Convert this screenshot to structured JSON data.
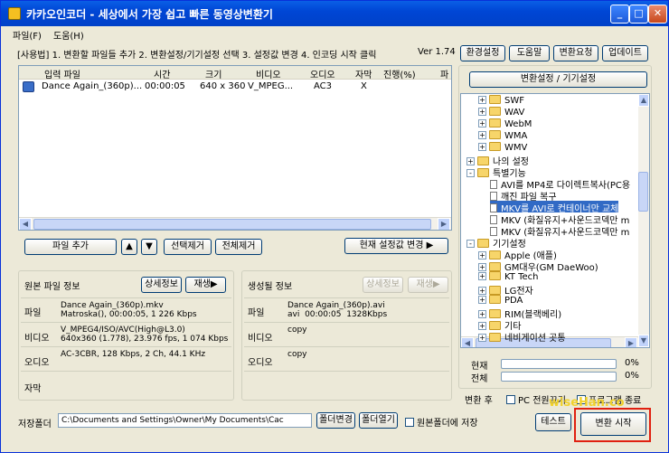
{
  "window": {
    "title": "카카오인코더 - 세상에서 가장 쉽고 빠른 동영상변환기"
  },
  "titlebar_buttons": {
    "minimize": "_",
    "maximize": "□",
    "close": "✕"
  },
  "menu": [
    "파일(F)",
    "도움(H)"
  ],
  "usage": "[사용법] 1. 변환할 파일들 추가  2. 변환설정/기기설정 선택  3. 설정값 변경  4. 인코딩 시작 클릭",
  "version": "Ver 1.74",
  "top_buttons": {
    "settings": "환경설정",
    "help": "도움말",
    "request": "변환요청",
    "update": "업데이트"
  },
  "grid": {
    "headers": [
      "입력 파일",
      "시간",
      "크기",
      "비디오",
      "오디오",
      "자막",
      "진행(%)",
      "파"
    ],
    "rows": [
      {
        "file": "Dance Again_(360p)...",
        "time": "00:00:05",
        "size": "640 x 360",
        "video": "V_MPEG...",
        "audio": "AC3",
        "sub": "X",
        "progress": ""
      }
    ]
  },
  "list_buttons": {
    "add": "파일 추가",
    "up": "▲",
    "down": "▼",
    "remove_sel": "선택제거",
    "remove_all": "전체제거",
    "apply": "현재 설정값 변경 ▶"
  },
  "source_info": {
    "title": "원본 파일 정보",
    "detail_btn": "상세정보",
    "play_btn": "재생▶",
    "labels": [
      "파일",
      "비디오",
      "오디오",
      "자막"
    ],
    "file": "Dance Again_(360p).mkv\nMatroska(), 00:00:05, 1 226 Kbps",
    "video": "V_MPEG4/ISO/AVC(High@L3.0)\n640x360 (1.778), 23.976 fps, 1 074 Kbps",
    "audio": "AC-3CBR, 128 Kbps, 2 Ch, 44.1 KHz",
    "sub": ""
  },
  "output_info": {
    "title": "생성될 정보",
    "detail_btn": "상세정보",
    "play_btn": "재생▶",
    "labels": [
      "파일",
      "비디오",
      "오디오"
    ],
    "file": "Dance Again_(360p).avi\navi  00:00:05  1328Kbps",
    "video": "copy",
    "audio": "copy"
  },
  "device_panel": {
    "title": "변환설정 / 기기설정"
  },
  "tree": [
    {
      "kind": "folder",
      "plus": "+",
      "label": "SWF",
      "indent": 1
    },
    {
      "kind": "folder",
      "plus": "+",
      "label": "WAV",
      "indent": 1
    },
    {
      "kind": "folder",
      "plus": "+",
      "label": "WebM",
      "indent": 1
    },
    {
      "kind": "folder",
      "plus": "+",
      "label": "WMA",
      "indent": 1
    },
    {
      "kind": "folder",
      "plus": "+",
      "label": "WMV",
      "indent": 1
    },
    {
      "kind": "folder",
      "plus": "+",
      "label": "나의 설정",
      "indent": 0
    },
    {
      "kind": "folder",
      "plus": "-",
      "label": "특별기능",
      "indent": 0
    },
    {
      "kind": "doc",
      "plus": "",
      "label": "AVI를 MP4로 다이렉트복사(PC용",
      "indent": 2
    },
    {
      "kind": "doc",
      "plus": "",
      "label": "깨진 파일 복구",
      "indent": 2
    },
    {
      "kind": "doc",
      "plus": "",
      "label": "MKV를 AVI로 컨테이너만 교체",
      "indent": 2,
      "selected": true
    },
    {
      "kind": "doc",
      "plus": "",
      "label": "MKV (화질유지+사운드코덱만 m",
      "indent": 2
    },
    {
      "kind": "doc",
      "plus": "",
      "label": "MKV (화질유지+사운드코덱만 m",
      "indent": 2
    },
    {
      "kind": "folder",
      "plus": "-",
      "label": "기기설정",
      "indent": 0
    },
    {
      "kind": "folder",
      "plus": "+",
      "label": "Apple (애플)",
      "indent": 1
    },
    {
      "kind": "folder",
      "plus": "+",
      "label": "GM대우(GM DaeWoo)",
      "indent": 1
    },
    {
      "kind": "folder",
      "plus": "+",
      "label": "KT Tech",
      "indent": 1
    },
    {
      "kind": "folder",
      "plus": "+",
      "label": "LG전자",
      "indent": 1
    },
    {
      "kind": "folder",
      "plus": "+",
      "label": "PDA",
      "indent": 1
    },
    {
      "kind": "folder",
      "plus": "+",
      "label": "RIM(블랙베리)",
      "indent": 1
    },
    {
      "kind": "folder",
      "plus": "+",
      "label": "기타",
      "indent": 1
    },
    {
      "kind": "folder",
      "plus": "+",
      "label": "네비게이션 곳통",
      "indent": 1
    }
  ],
  "progress": {
    "current_label": "현재",
    "total_label": "전체",
    "current": "0%",
    "total": "0%",
    "current_value": 0,
    "total_value": 0
  },
  "after_convert": {
    "label": "변환 후",
    "pc_off": "PC 전원끄기",
    "quit": "프로그램 종료"
  },
  "save": {
    "label": "저장폴더",
    "path": "C:\\Documents and Settings\\Owner\\My Documents\\Cac",
    "change_btn": "폴더변경",
    "open_btn": "폴더열기",
    "same_folder": "원본폴더에 저장"
  },
  "bottom_buttons": {
    "test": "테스트",
    "start": "변환 시작"
  },
  "watermark": "wiseHan.co"
}
